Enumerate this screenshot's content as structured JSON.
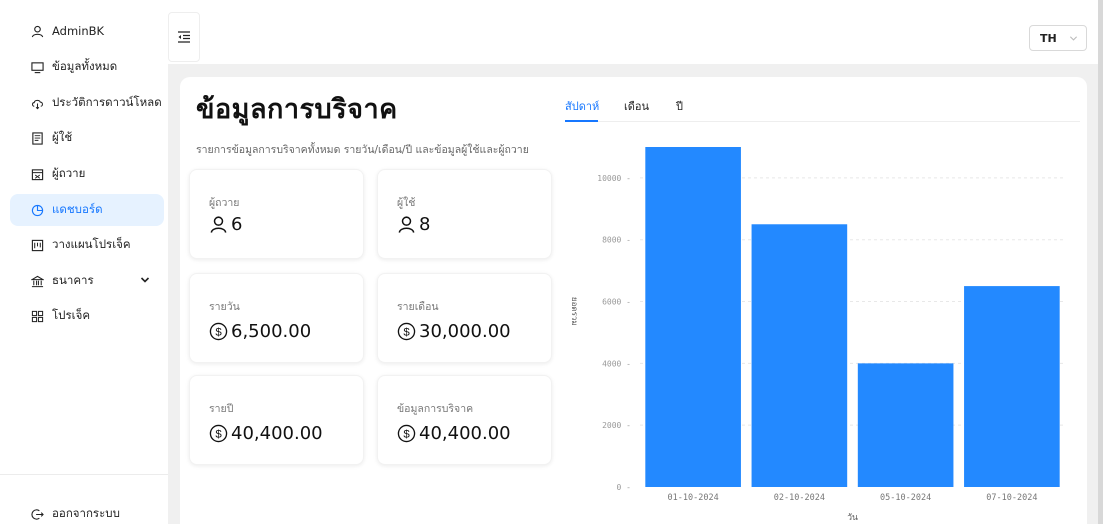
{
  "sidebar": {
    "items": [
      {
        "label": "AdminBK",
        "icon": "user-icon"
      },
      {
        "label": "ข้อมูลทั้งหมด",
        "icon": "monitor-icon"
      },
      {
        "label": "ประวัติการดาวน์โหลด",
        "icon": "cloud-download-icon"
      },
      {
        "label": "ผู้ใช้",
        "icon": "id-card-icon"
      },
      {
        "label": "ผู้ถวาย",
        "icon": "calendar-icon"
      },
      {
        "label": "แดชบอร์ด",
        "icon": "pie-chart-icon",
        "active": true
      },
      {
        "label": "วางแผนโปรเจ็ค",
        "icon": "project-icon"
      },
      {
        "label": "ธนาคาร",
        "icon": "bank-icon",
        "expandable": true
      },
      {
        "label": "โปรเจ็ค",
        "icon": "grid-icon"
      }
    ],
    "logout_label": "ออกจากระบบ"
  },
  "header": {
    "language": "TH"
  },
  "main": {
    "title": "ข้อมูลการบริจาค",
    "subtitle": "รายการข้อมูลการบริจาคทั้งหมด รายวัน/เดือน/ปี และข้อมูลผู้ใช้และผู้ถวาย",
    "stats": [
      {
        "label": "ผู้ถวาย",
        "value": "6",
        "icon": "user-icon"
      },
      {
        "label": "ผู้ใช้",
        "value": "8",
        "icon": "user-icon"
      },
      {
        "label": "รายวัน",
        "value": "6,500.00",
        "icon": "dollar-circle-icon"
      },
      {
        "label": "รายเดือน",
        "value": "30,000.00",
        "icon": "dollar-circle-icon"
      },
      {
        "label": "รายปี",
        "value": "40,400.00",
        "icon": "dollar-circle-icon"
      },
      {
        "label": "ข้อมูลการบริจาค",
        "value": "40,400.00",
        "icon": "dollar-circle-icon"
      }
    ],
    "tabs": [
      {
        "label": "สัปดาห์",
        "active": true
      },
      {
        "label": "เดือน",
        "active": false
      },
      {
        "label": "ปี",
        "active": false
      }
    ]
  },
  "colors": {
    "accent": "#1677ff",
    "bar": "#2389ff",
    "active_bg": "#e6f2ff"
  },
  "chart_data": {
    "type": "bar",
    "categories": [
      "01-10-2024",
      "02-10-2024",
      "05-10-2024",
      "07-10-2024"
    ],
    "values": [
      11000,
      8500,
      4000,
      6500
    ],
    "yticks": [
      "0",
      "2000",
      "4000",
      "6000",
      "8000",
      "10000"
    ],
    "ylabel": "ยอดรวม",
    "xlabel": "วัน",
    "ylim": [
      0,
      11000
    ],
    "grid": true
  }
}
